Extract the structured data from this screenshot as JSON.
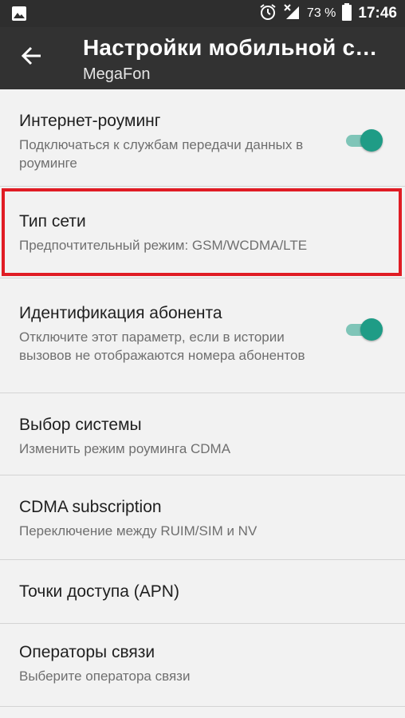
{
  "status_bar": {
    "battery_percent": "73 %",
    "time": "17:46"
  },
  "toolbar": {
    "title": "Настройки мобильной сет...",
    "subtitle": "MegaFon"
  },
  "settings": {
    "items": [
      {
        "title": "Интернет-роуминг",
        "summary": "Подключаться к службам передачи данных в роуминге",
        "switch_on": true
      },
      {
        "title": "Тип сети",
        "summary": "Предпочтительный режим: GSM/WCDMA/LTE",
        "highlighted": true
      },
      {
        "title": "Идентификация абонента",
        "summary": "Отключите этот параметр, если в истории вызовов не отображаются номера абонентов",
        "switch_on": true
      },
      {
        "title": "Выбор системы",
        "summary": "Изменить режим роуминга CDMA"
      },
      {
        "title": "CDMA subscription",
        "summary": "Переключение между RUIM/SIM и NV"
      },
      {
        "title": "Точки доступа (APN)"
      },
      {
        "title": "Операторы связи",
        "summary": "Выберите оператора связи"
      }
    ]
  },
  "colors": {
    "accent": "#1f9c86",
    "highlight": "#e01c24",
    "toolbar": "#323232"
  },
  "icons": [
    "image-icon",
    "alarm-icon",
    "no-signal-icon",
    "battery-icon",
    "back-arrow-icon"
  ]
}
